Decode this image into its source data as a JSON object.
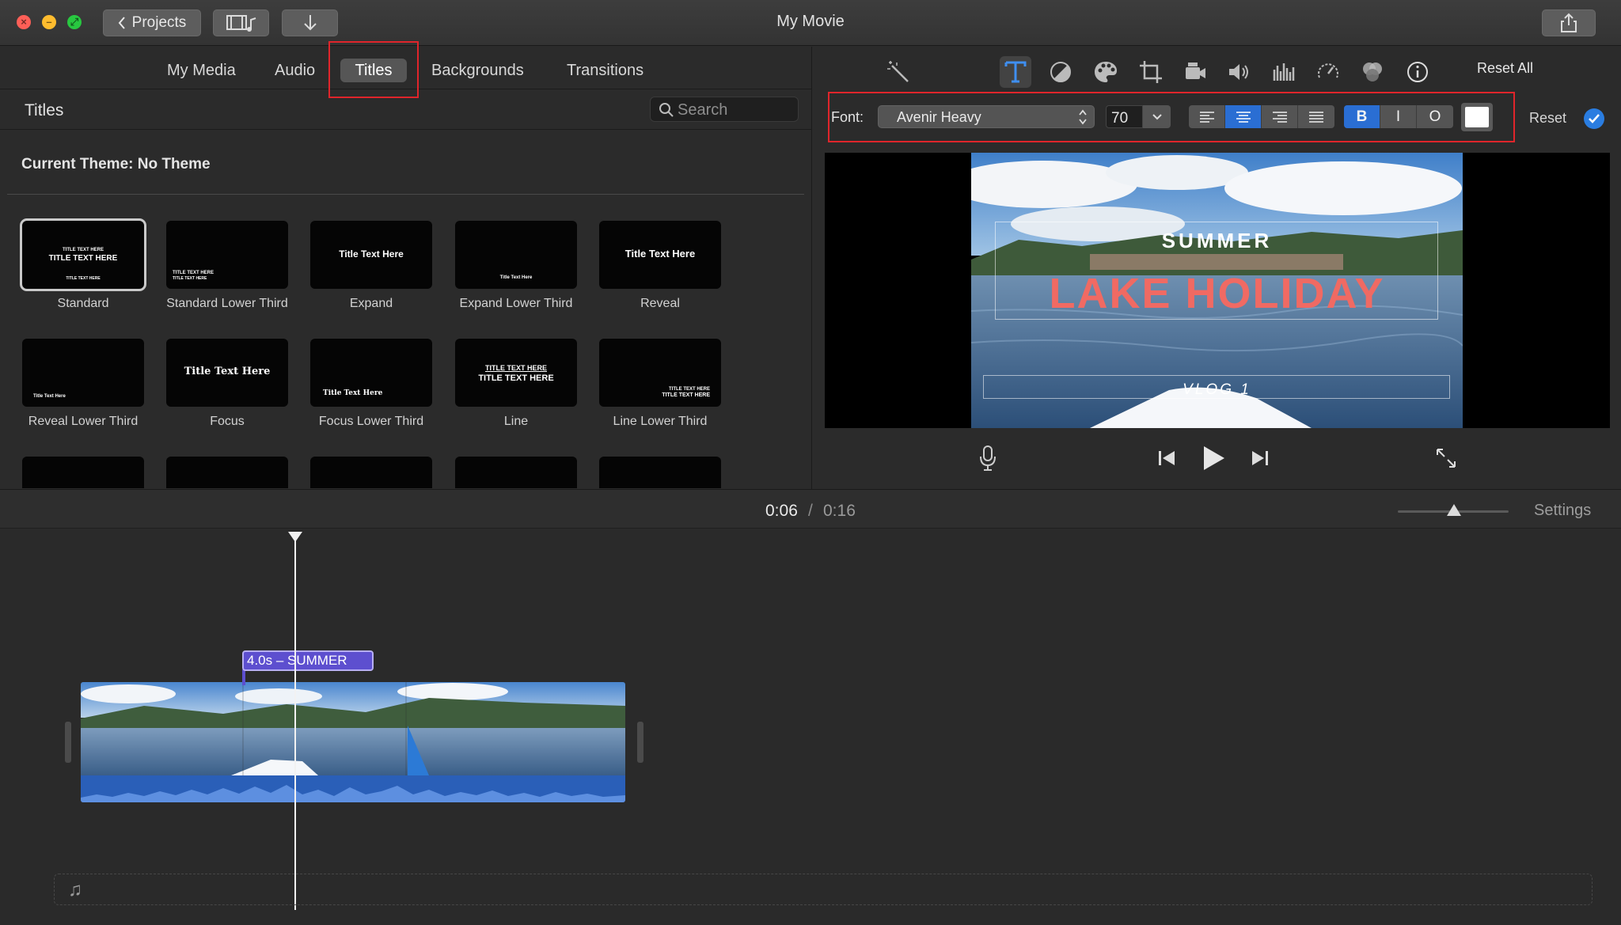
{
  "window": {
    "title": "My Movie",
    "projects_label": "Projects"
  },
  "browser": {
    "tabs": [
      "My Media",
      "Audio",
      "Titles",
      "Backgrounds",
      "Transitions"
    ],
    "active_tab": "Titles",
    "section_title": "Titles",
    "search_placeholder": "Search",
    "theme_label": "Current Theme: No Theme",
    "titles": [
      {
        "label": "Standard",
        "selected": true
      },
      {
        "label": "Standard Lower Third",
        "selected": false
      },
      {
        "label": "Expand",
        "selected": false
      },
      {
        "label": "Expand Lower Third",
        "selected": false
      },
      {
        "label": "Reveal",
        "selected": false
      },
      {
        "label": "Reveal Lower Third",
        "selected": false
      },
      {
        "label": "Focus",
        "selected": false
      },
      {
        "label": "Focus Lower Third",
        "selected": false
      },
      {
        "label": "Line",
        "selected": false
      },
      {
        "label": "Line Lower Third",
        "selected": false
      }
    ],
    "thumb_text": {
      "caps": "TITLE TEXT HERE",
      "mixed": "Title Text Here"
    }
  },
  "viewer": {
    "reset_all": "Reset All",
    "font_label": "Font:",
    "font_value": "Avenir Heavy",
    "font_size": "70",
    "bold": "B",
    "italic": "I",
    "outline": "O",
    "text_color": "#ffffff",
    "reset": "Reset",
    "preview": {
      "line1": "SUMMER",
      "line2": "LAKE HOLIDAY",
      "line3": "VLOG 1",
      "line2_color": "#f06a63"
    }
  },
  "timeline": {
    "current_time": "0:06",
    "separator": "/",
    "total_time": "0:16",
    "settings": "Settings",
    "title_clip_label": "4.0s – SUMMER"
  },
  "colors": {
    "accent_blue": "#2a6ed3",
    "highlight_red": "#e0252b",
    "title_clip": "#5d4fcf"
  }
}
